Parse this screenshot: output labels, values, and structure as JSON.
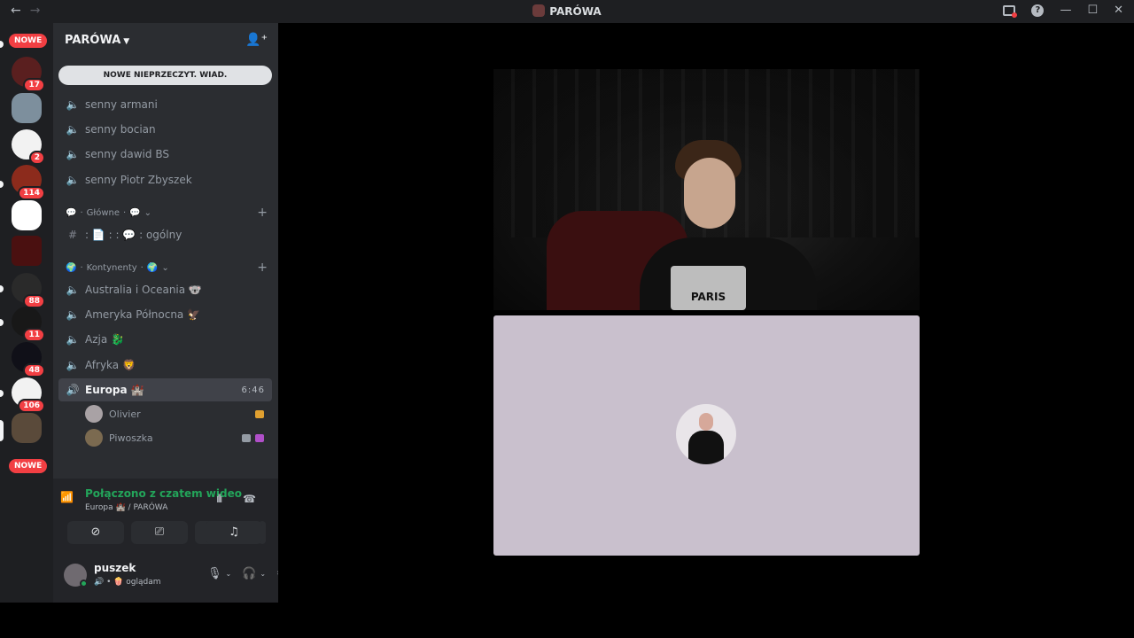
{
  "window": {
    "title": "PARÓWA",
    "back": "←",
    "forward": "→",
    "help": "?",
    "minimize": "—",
    "maximize": "☐",
    "close": "✕"
  },
  "guilds": {
    "new_top": "NOWE",
    "new_bottom": "NOWE",
    "badges": [
      "17",
      "2",
      "114",
      "88",
      "11",
      "48",
      "106"
    ]
  },
  "server": {
    "name": "PARÓWA",
    "new_unread": "NOWE NIEPRZECZYT. WIAD."
  },
  "channels_top": [
    {
      "name": "senny armani"
    },
    {
      "name": "senny bocian"
    },
    {
      "name": "senny dawid BS"
    },
    {
      "name": "senny Piotr Zbyszek"
    }
  ],
  "category_main": {
    "label": "Główne",
    "emoji": "💬"
  },
  "text_channel": {
    "name": "ogólny",
    "prefix": ":  📄  :  :  💬  :"
  },
  "category_continents": {
    "label": "Kontynenty",
    "emoji": "🌍"
  },
  "channels_continents": [
    {
      "name": "Australia i Oceania 🐨"
    },
    {
      "name": "Ameryka Północna 🦅"
    },
    {
      "name": "Azja 🐉"
    },
    {
      "name": "Afryka 🦁"
    }
  ],
  "active_channel": {
    "name": "Europa 🏰",
    "time": "6:46"
  },
  "voice_users": [
    {
      "name": "Olivier"
    },
    {
      "name": "Piwoszka"
    }
  ],
  "voice_panel": {
    "status": "Połączono z czatem wideo",
    "location": "Europa 🏰 / PARÓWA"
  },
  "account": {
    "name": "puszek",
    "status": "🔊 • 🍿 oglądam"
  },
  "video": {
    "shirt_text": "PARIS"
  }
}
